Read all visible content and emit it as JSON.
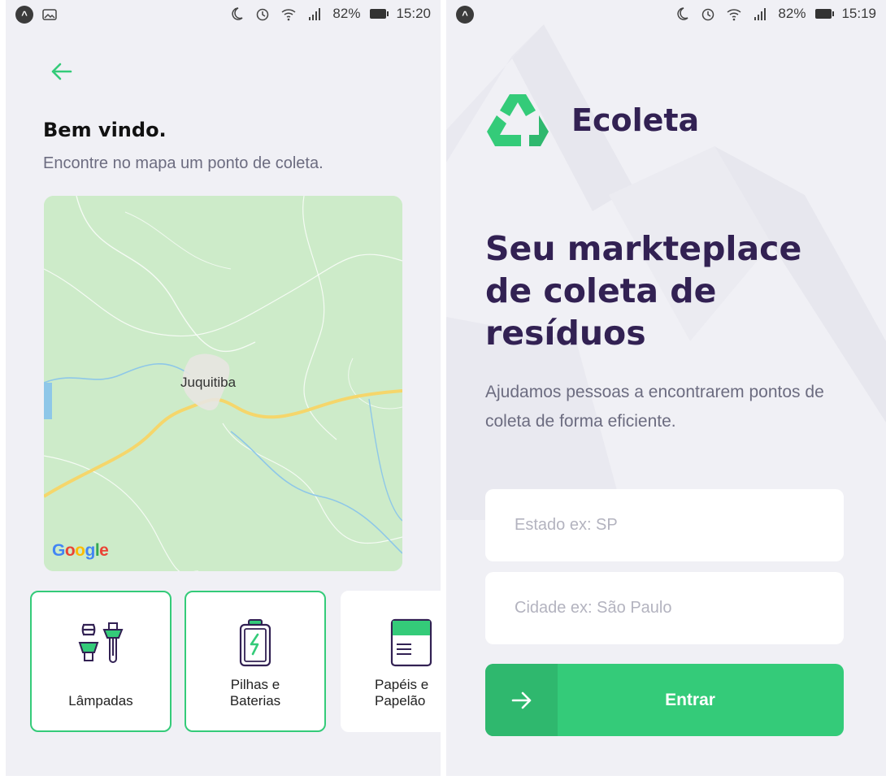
{
  "left_screen": {
    "status": {
      "battery": "82%",
      "time": "15:20"
    },
    "title": "Bem vindo.",
    "subtitle": "Encontre no mapa um ponto de coleta.",
    "map": {
      "city_label": "Juquitiba",
      "attribution": "Google"
    },
    "items": [
      {
        "line1": "Lâmpadas",
        "line2": "",
        "icon": "lamp-icon",
        "selected": true
      },
      {
        "line1": "Pilhas e",
        "line2": "Baterias",
        "icon": "battery-icon",
        "selected": true
      },
      {
        "line1": "Papéis e",
        "line2": "Papelão",
        "icon": "paper-icon",
        "selected": false
      }
    ]
  },
  "right_screen": {
    "status": {
      "battery": "82%",
      "time": "15:19"
    },
    "brand": "Ecoleta",
    "headline": "Seu markteplace de coleta de resíduos",
    "description": "Ajudamos pessoas a encontrarem pontos de coleta de forma eficiente.",
    "state_placeholder": "Estado ex: SP",
    "city_placeholder": "Cidade ex: São Paulo",
    "button_label": "Entrar"
  },
  "colors": {
    "primary": "#34cb79",
    "title": "#322153",
    "text": "#6c6c80",
    "background": "#f0f0f5"
  }
}
